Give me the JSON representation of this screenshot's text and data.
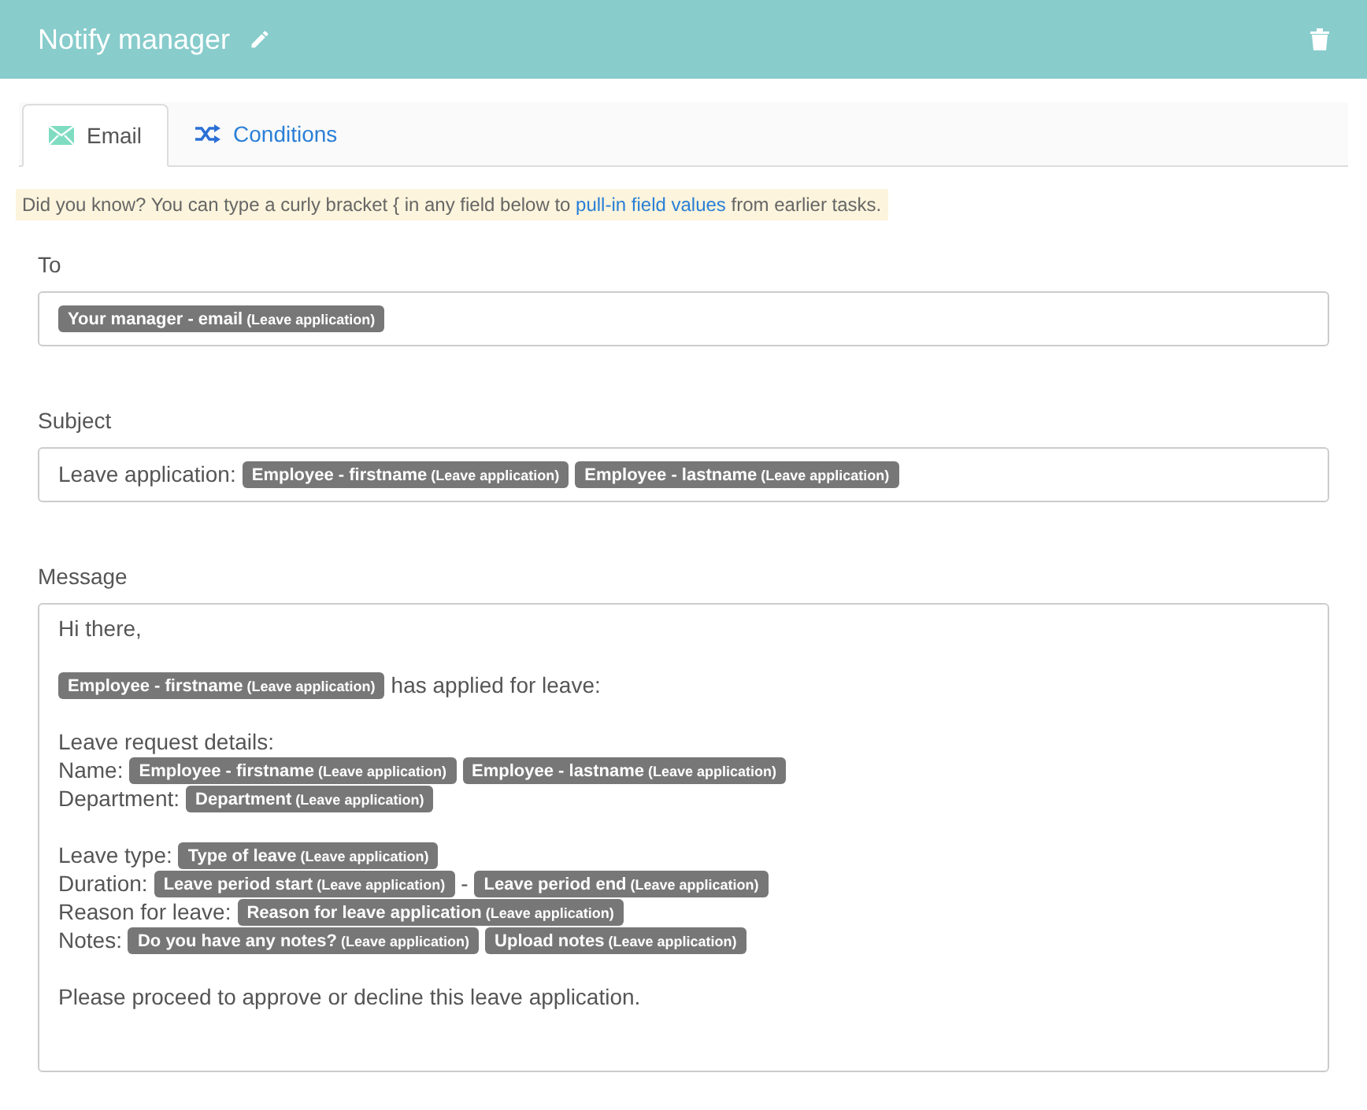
{
  "header": {
    "title": "Notify manager"
  },
  "tabs": [
    {
      "label": "Email",
      "selected": true
    },
    {
      "label": "Conditions",
      "selected": false
    }
  ],
  "hint": {
    "before": "Did you know? You can type a curly bracket { in any field below to ",
    "link": "pull-in field values",
    "after": " from earlier tasks."
  },
  "fields": [
    {
      "label": "To",
      "paragraphs": [
        [
          [
            {
              "kind": "token",
              "label": "Your manager - email",
              "source": "(Leave application)"
            }
          ]
        ]
      ]
    },
    {
      "label": "Subject",
      "paragraphs": [
        [
          [
            {
              "kind": "text",
              "text": "Leave application:"
            },
            {
              "kind": "token",
              "label": "Employee - firstname",
              "source": "(Leave application)"
            },
            {
              "kind": "token",
              "label": "Employee - lastname",
              "source": "(Leave application)"
            }
          ]
        ]
      ]
    },
    {
      "label": "Message",
      "paragraphs": [
        [
          [
            {
              "kind": "text",
              "text": "Hi there,"
            }
          ]
        ],
        [
          [
            {
              "kind": "token",
              "label": "Employee - firstname",
              "source": "(Leave application)"
            },
            {
              "kind": "text",
              "text": "has applied for leave:"
            }
          ]
        ],
        [
          [
            {
              "kind": "text",
              "text": "Leave request details:"
            }
          ],
          [
            {
              "kind": "text",
              "text": "Name:"
            },
            {
              "kind": "token",
              "label": "Employee - firstname",
              "source": "(Leave application)"
            },
            {
              "kind": "token",
              "label": "Employee - lastname",
              "source": "(Leave application)"
            }
          ],
          [
            {
              "kind": "text",
              "text": "Department:"
            },
            {
              "kind": "token",
              "label": "Department",
              "source": "(Leave application)"
            }
          ]
        ],
        [
          [
            {
              "kind": "text",
              "text": "Leave type:"
            },
            {
              "kind": "token",
              "label": "Type of leave",
              "source": "(Leave application)"
            }
          ],
          [
            {
              "kind": "text",
              "text": "Duration:"
            },
            {
              "kind": "token",
              "label": "Leave period start",
              "source": "(Leave application)"
            },
            {
              "kind": "text",
              "text": "-"
            },
            {
              "kind": "token",
              "label": "Leave period end",
              "source": "(Leave application)"
            }
          ],
          [
            {
              "kind": "text",
              "text": "Reason for leave:"
            },
            {
              "kind": "token",
              "label": "Reason for leave application",
              "source": "(Leave application)"
            }
          ],
          [
            {
              "kind": "text",
              "text": "Notes:"
            },
            {
              "kind": "token",
              "label": "Do you have any notes?",
              "source": "(Leave application)"
            },
            {
              "kind": "token",
              "label": "Upload notes",
              "source": "(Leave application)"
            }
          ]
        ],
        [
          [
            {
              "kind": "text",
              "text": "Please proceed to approve or decline this leave application."
            }
          ]
        ]
      ]
    }
  ]
}
